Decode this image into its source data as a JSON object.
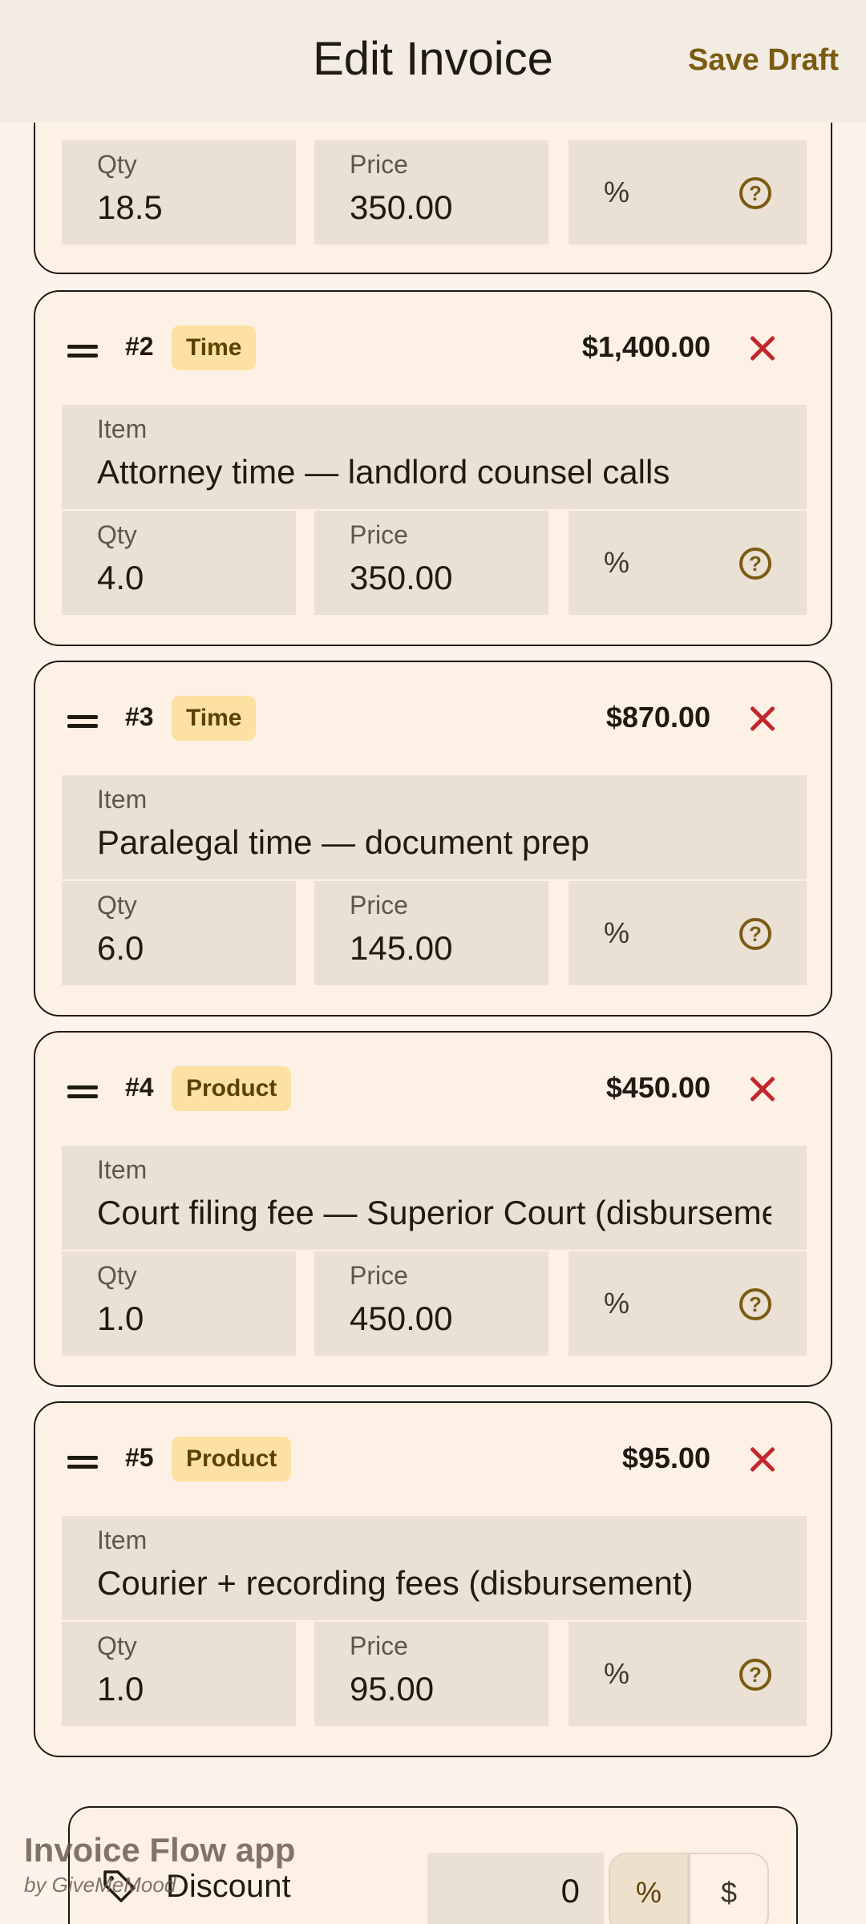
{
  "app_bar": {
    "title": "Edit Invoice",
    "save_label": "Save Draft"
  },
  "colors": {
    "accent": "#7a5b12",
    "badge_bg": "#fce1a3",
    "remove": "#c2272d",
    "field_bg": "#ebe0d4"
  },
  "partial_card": {
    "qty_label": "Qty",
    "qty": "18.5",
    "price_label": "Price",
    "price": "350.00",
    "discount_symbol": "%"
  },
  "line_items": [
    {
      "number": "#2",
      "type": "Time",
      "total": "$1,400.00",
      "item_label": "Item",
      "item": "Attorney time — landlord counsel calls",
      "qty_label": "Qty",
      "qty": "4.0",
      "price_label": "Price",
      "price": "350.00",
      "discount_symbol": "%"
    },
    {
      "number": "#3",
      "type": "Time",
      "total": "$870.00",
      "item_label": "Item",
      "item": "Paralegal time — document prep",
      "qty_label": "Qty",
      "qty": "6.0",
      "price_label": "Price",
      "price": "145.00",
      "discount_symbol": "%"
    },
    {
      "number": "#4",
      "type": "Product",
      "total": "$450.00",
      "item_label": "Item",
      "item": "Court filing fee — Superior Court (disbursement)",
      "qty_label": "Qty",
      "qty": "1.0",
      "price_label": "Price",
      "price": "450.00",
      "discount_symbol": "%"
    },
    {
      "number": "#5",
      "type": "Product",
      "total": "$95.00",
      "item_label": "Item",
      "item": "Courier + recording fees (disbursement)",
      "qty_label": "Qty",
      "qty": "1.0",
      "price_label": "Price",
      "price": "95.00",
      "discount_symbol": "%"
    }
  ],
  "discount": {
    "label": "Discount",
    "value": "0",
    "mode_percent": "%",
    "mode_dollar": "$",
    "selected_mode": "%"
  },
  "watermark": {
    "title": "Invoice Flow app",
    "subtitle": "by GiveMeMood"
  }
}
